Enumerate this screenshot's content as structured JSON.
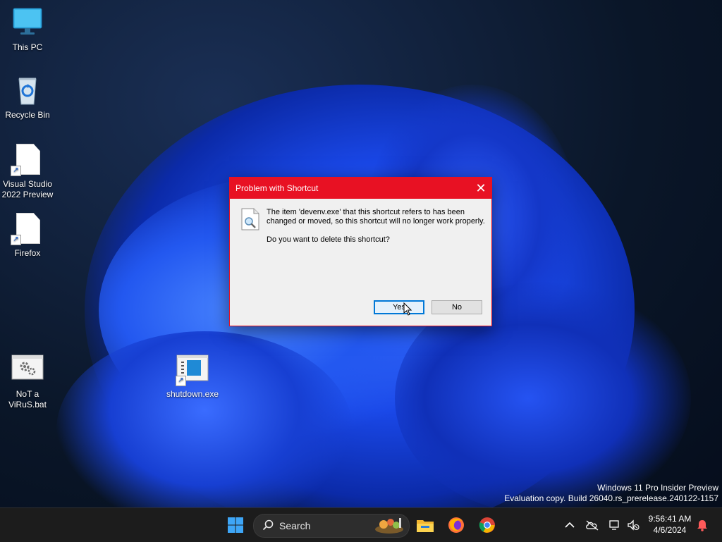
{
  "desktop": {
    "icons": [
      {
        "label": "This PC"
      },
      {
        "label": "Recycle Bin"
      },
      {
        "label": "Visual Studio\n2022 Preview"
      },
      {
        "label": "Firefox"
      },
      {
        "label": "NoT a\nViRuS.bat"
      },
      {
        "label": "shutdown.exe"
      }
    ]
  },
  "dialog": {
    "title": "Problem with Shortcut",
    "message": "The item 'devenv.exe' that this shortcut refers to has been changed or moved, so this shortcut will no longer work properly.",
    "question": "Do you want to delete this shortcut?",
    "yes_label": "Yes",
    "no_label": "No",
    "accent_color": "#e81123"
  },
  "watermark": {
    "line1": "Windows 11 Pro Insider Preview",
    "line2": "Evaluation copy. Build 26040.rs_prerelease.240122-1157"
  },
  "taskbar": {
    "search_placeholder": "Search",
    "pinned": [
      "windows-start-icon",
      "file-explorer-icon",
      "firefox-icon",
      "chrome-icon"
    ],
    "clock_time": "9:56:41 AM",
    "clock_date": "4/6/2024"
  }
}
